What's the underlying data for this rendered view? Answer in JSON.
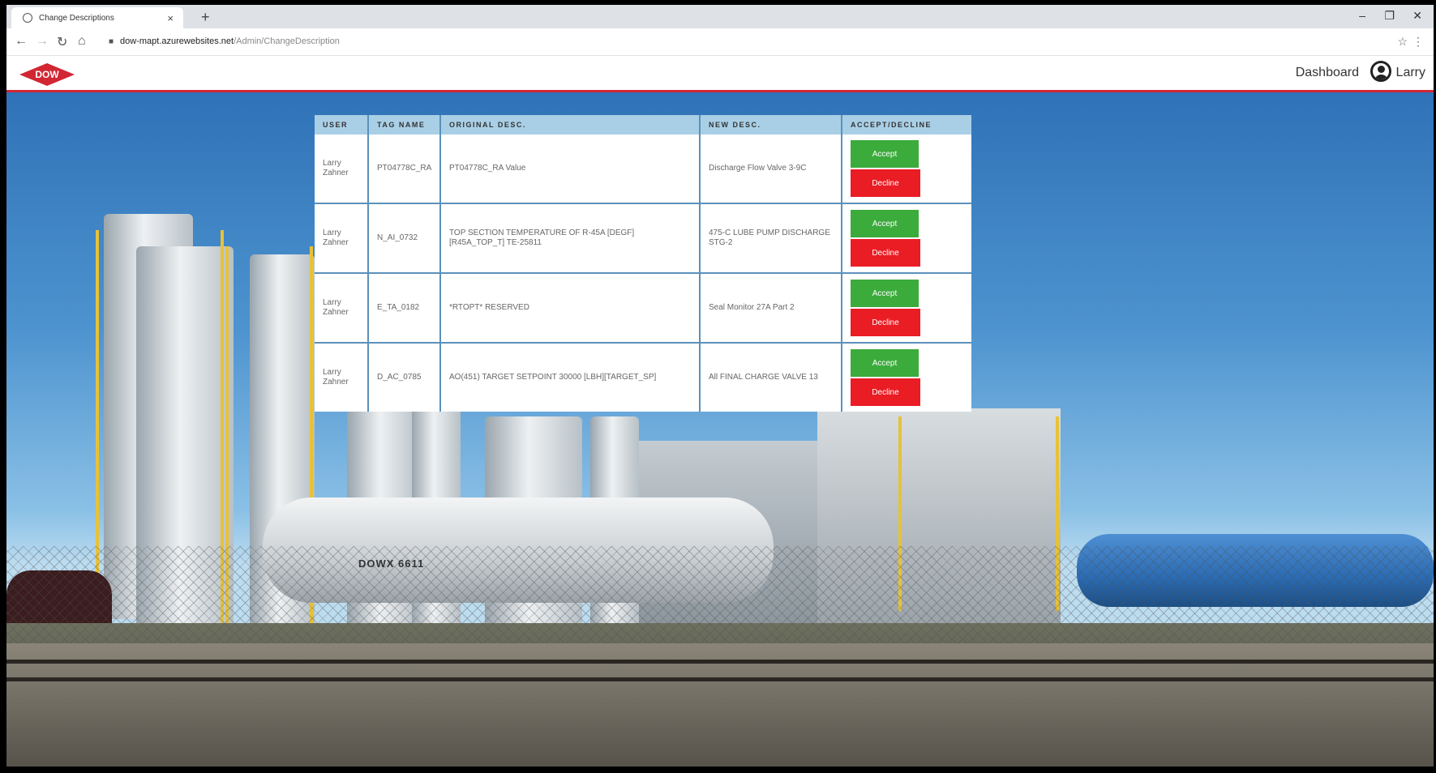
{
  "browser": {
    "tab_title": "Change Descriptions",
    "tab_close": "×",
    "new_tab": "+",
    "url_host": "dow-mapt.azurewebsites.net",
    "url_path": "/Admin/ChangeDescription"
  },
  "header": {
    "logo_text": "DOW",
    "dashboard_link": "Dashboard",
    "user_name": "Larry",
    "brand_color": "#d22633"
  },
  "background": {
    "railcar_marking": "DOWX 6611"
  },
  "table": {
    "columns": [
      "USER",
      "TAG NAME",
      "ORIGINAL DESC.",
      "NEW DESC.",
      "ACCEPT/DECLINE"
    ],
    "rows": [
      {
        "user_first": "Larry",
        "user_last": "Zahner",
        "tag": "PT04778C_RA",
        "original": "PT04778C_RA Value",
        "new": "Discharge Flow Valve 3-9C"
      },
      {
        "user_first": "Larry",
        "user_last": "Zahner",
        "tag": "N_AI_0732",
        "original": "TOP SECTION TEMPERATURE OF R-45A [DEGF] [R45A_TOP_T] TE-25811",
        "new": "475-C LUBE PUMP DISCHARGE STG-2"
      },
      {
        "user_first": "Larry",
        "user_last": "Zahner",
        "tag": "E_TA_0182",
        "original": "*RTOPT* RESERVED",
        "new": "Seal Monitor 27A Part 2"
      },
      {
        "user_first": "Larry",
        "user_last": "Zahner",
        "tag": "D_AC_0785",
        "original": "AO(451) TARGET SETPOINT 30000 [LBH][TARGET_SP]",
        "new": "All FINAL CHARGE VALVE 13"
      }
    ],
    "accept_label": "Accept",
    "decline_label": "Decline",
    "accept_color": "#3bab3b",
    "decline_color": "#ea1c24"
  }
}
